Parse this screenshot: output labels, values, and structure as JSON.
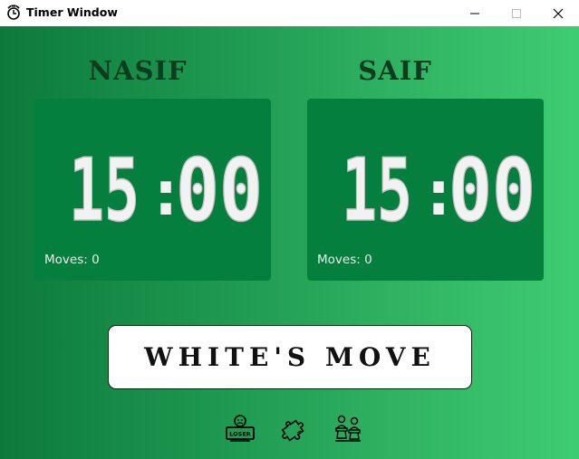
{
  "window": {
    "title": "Timer Window",
    "controls": [
      "minimize",
      "maximize",
      "close"
    ]
  },
  "players": [
    {
      "name": "NASIF",
      "time": {
        "minutes": "15",
        "separator": ":",
        "seconds": "00"
      },
      "moves_label": "Moves: 0"
    },
    {
      "name": "SAIF",
      "time": {
        "minutes": "15",
        "separator": ":",
        "seconds": "00"
      },
      "moves_label": "Moves: 0"
    }
  ],
  "turn_indicator": "WHITE'S MOVE",
  "toolbar_icons": [
    "loser-icon",
    "puzzle-icon",
    "chess-players-icon"
  ],
  "badge_text": "LOSER",
  "colors": {
    "gradient_left": "#0d7a3b",
    "gradient_right": "#3ecc72",
    "clock_panel": "#047f3d",
    "player_name": "#0f3b1e",
    "digit_fill": "#f2f2f2"
  }
}
